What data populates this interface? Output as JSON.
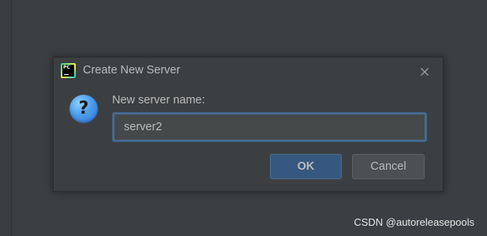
{
  "dialog": {
    "title": "Create New Server",
    "app_icon": "pycharm-logo-icon",
    "app_icon_text": "PC",
    "close_icon": "close-icon",
    "question_icon": "question-icon",
    "question_glyph": "?",
    "prompt": "New server name:",
    "input_value": "server2",
    "ok_label": "OK",
    "cancel_label": "Cancel"
  },
  "watermark": "CSDN @autoreleasepools",
  "colors": {
    "background": "#3c3f41",
    "text": "#bbbbbb",
    "input_focus_border": "#466d94",
    "ok_button": "#365880",
    "cancel_button": "#4c5052"
  }
}
